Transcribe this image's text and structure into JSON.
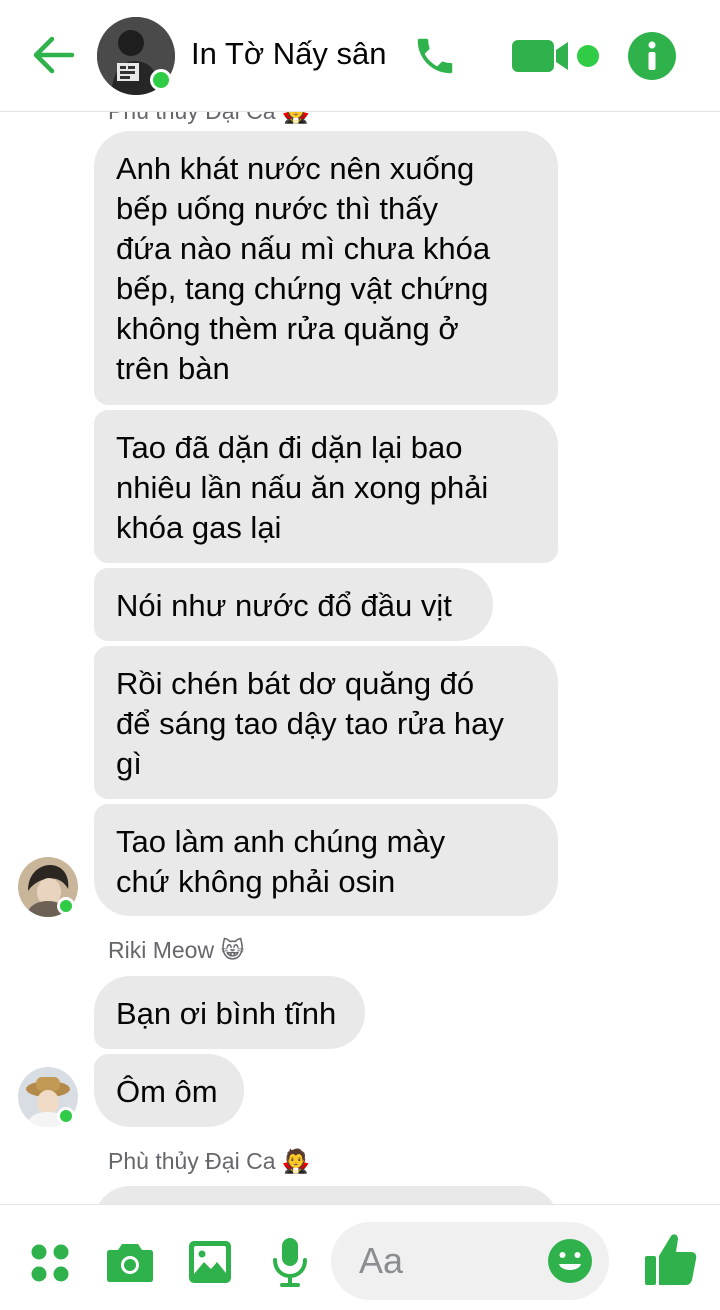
{
  "header": {
    "title": "In Tờ Nấy sân"
  },
  "colors": {
    "accent": "#2fb24c",
    "bubble": "#e9e9e9",
    "online": "#31cc46",
    "sender_text": "#65676b"
  },
  "icons": {
    "back": "arrow-left-icon",
    "call": "phone-icon",
    "video": "video-camera-icon",
    "info": "info-icon",
    "menu": "four-dots-icon",
    "camera": "camera-icon",
    "gallery": "image-icon",
    "mic": "microphone-icon",
    "emoji": "smiley-icon",
    "like": "thumbs-up-icon"
  },
  "thread": {
    "sender_top": "Phù thủy Đại Ca 🧛",
    "group1": [
      "Anh khát nước nên xuống\nbếp uống nước thì thấy\nđứa nào nấu mì chưa khóa\nbếp, tang chứng vật chứng\nkhông thèm rửa quăng ở\ntrên bàn",
      "Tao đã dặn đi dặn lại bao\nnhiêu lần nấu ăn xong phải\nkhóa gas lại",
      "Nói như nước đổ đầu vịt",
      "Rồi chén bát dơ quăng đó\nđể sáng tao dậy tao rửa hay\ngì",
      "Tao làm anh chúng mày\nchứ không phải osin"
    ],
    "sender2": "Riki Meow 😸",
    "group2": [
      "Bạn ơi bình tĩnh",
      "Ôm ôm"
    ],
    "sender3": "Phù thủy Đại Ca 🧛"
  },
  "composer": {
    "placeholder": "Aa"
  }
}
